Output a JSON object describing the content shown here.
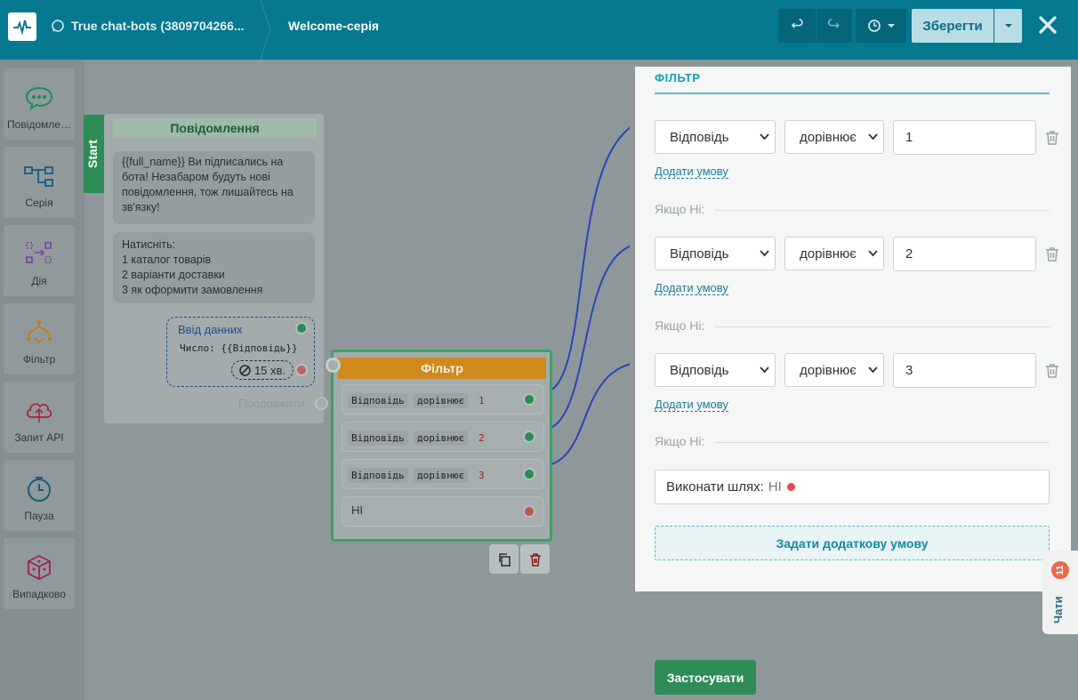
{
  "header": {
    "bot_name": "True chat-bots (3809704266...",
    "flow_name": "Welcome-серія",
    "save_label": "Зберегти"
  },
  "sidebar": {
    "items": [
      {
        "label": "Повідомлення",
        "icon": "chat-icon"
      },
      {
        "label": "Серія",
        "icon": "series-icon"
      },
      {
        "label": "Дія",
        "icon": "action-icon"
      },
      {
        "label": "Фільтр",
        "icon": "filter-icon"
      },
      {
        "label": "Запит API",
        "icon": "cloud-api-icon"
      },
      {
        "label": "Пауза",
        "icon": "clock-icon"
      },
      {
        "label": "Випадково",
        "icon": "dice-icon"
      }
    ]
  },
  "message_node": {
    "start_label": "Start",
    "title": "Повідомлення",
    "bubble1": "{{full_name}}  Ви підписались на бота! Незабаром будуть нові повідомлення, тож лишайтесь на зв'язку!",
    "bubble2_lines": [
      "Натисніть:",
      "1 каталог товарів",
      "2 варіанти доставки",
      "3 як оформити замовлення"
    ],
    "input_title": "Ввід данних",
    "input_sub": "Число: {{Відповідь}}",
    "timer": "15 хв.",
    "continue_label": "Продовжити"
  },
  "filter_node": {
    "title": "Фільтр",
    "rows": [
      {
        "field": "Відповідь",
        "op": "дорівнює",
        "value": "1"
      },
      {
        "field": "Відповідь",
        "op": "дорівнює",
        "value": "2"
      },
      {
        "field": "Відповідь",
        "op": "дорівнює",
        "value": "3"
      }
    ],
    "no_label": "НІ"
  },
  "panel": {
    "title": "ФІЛЬТР",
    "conditions": [
      {
        "field": "Відповідь",
        "operator": "дорівнює",
        "value": "1"
      },
      {
        "field": "Відповідь",
        "operator": "дорівнює",
        "value": "2"
      },
      {
        "field": "Відповідь",
        "operator": "дорівнює",
        "value": "3"
      }
    ],
    "add_condition_label": "Додати умову",
    "else_label": "Якщо Ні:",
    "path_label": "Виконати шлях:",
    "path_value": "НІ",
    "add_extra_label": "Задати додаткову умову",
    "apply_label": "Застосувати"
  },
  "chats": {
    "label": "Чати",
    "count": "11"
  },
  "colors": {
    "header": "#06788f",
    "accent": "#11a0b8",
    "green": "#2e8c57",
    "filter_orange": "#cf8a1c",
    "danger": "#e54848"
  }
}
